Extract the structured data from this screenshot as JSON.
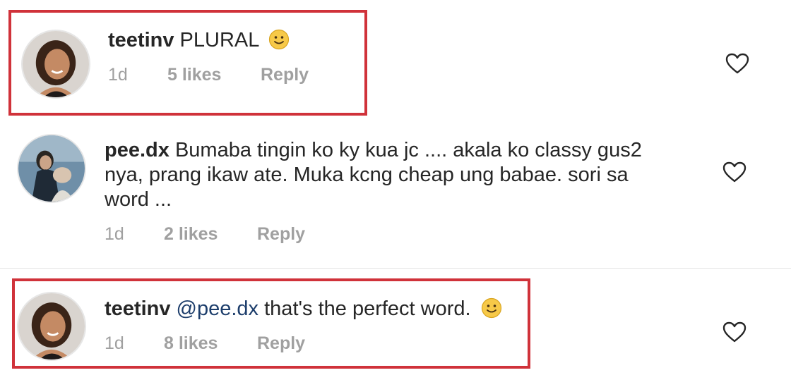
{
  "comments": [
    {
      "username": "teetinv",
      "text": "PLURAL",
      "emoji": "slightly-smiling-face",
      "time": "1d",
      "likes": "5 likes",
      "reply": "Reply"
    },
    {
      "username": "pee.dx",
      "text_lines": [
        "Bumaba tingin ko ky kua jc .... akala ko classy gus2",
        "nya, prang ikaw ate. Muka kcng cheap ung babae. sori sa",
        "word ..."
      ],
      "time": "1d",
      "likes": "2 likes",
      "reply": "Reply"
    },
    {
      "username": "teetinv",
      "mention": "@pee.dx",
      "text": "that's the perfect word.",
      "emoji": "slightly-smiling-face",
      "time": "1d",
      "likes": "8 likes",
      "reply": "Reply"
    }
  ],
  "icons": {
    "like": "heart-outline-icon",
    "emoji": "slightly-smiling-face-icon"
  },
  "colors": {
    "highlight_border": "#d0323a",
    "mention": "#1c3d6b",
    "meta_text": "#a0a0a0"
  }
}
